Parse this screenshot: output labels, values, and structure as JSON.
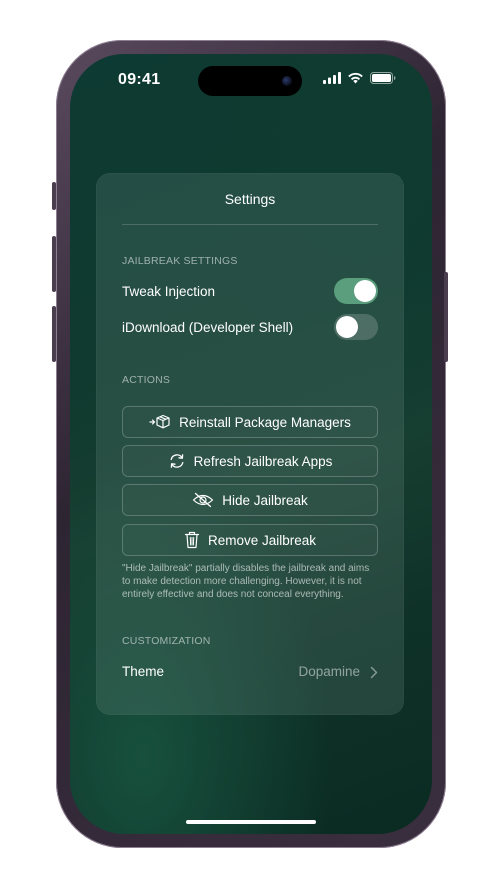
{
  "status_bar": {
    "time": "09:41"
  },
  "settings": {
    "title": "Settings",
    "jailbreak_section": {
      "header": "JAILBREAK SETTINGS",
      "toggles": [
        {
          "label": "Tweak Injection",
          "enabled": true
        },
        {
          "label": "iDownload (Developer Shell)",
          "enabled": false
        }
      ]
    },
    "actions_section": {
      "header": "ACTIONS",
      "buttons": [
        {
          "label": "Reinstall Package Managers",
          "icon": "shipping-box-icon"
        },
        {
          "label": "Refresh Jailbreak Apps",
          "icon": "refresh-icon"
        },
        {
          "label": "Hide Jailbreak",
          "icon": "eye-slash-icon"
        },
        {
          "label": "Remove Jailbreak",
          "icon": "trash-icon"
        }
      ],
      "footnote": "\"Hide Jailbreak\" partially disables the jailbreak and aims to make detection more challenging. However, it is not entirely effective and does not conceal everything."
    },
    "customization_section": {
      "header": "CUSTOMIZATION",
      "theme_label": "Theme",
      "theme_value": "Dopamine"
    }
  },
  "colors": {
    "toggle_on": "#5a9e7d",
    "toggle_off": "#4a5a55",
    "background_top": "#0d3a33",
    "background_bottom": "#0a2b22"
  }
}
